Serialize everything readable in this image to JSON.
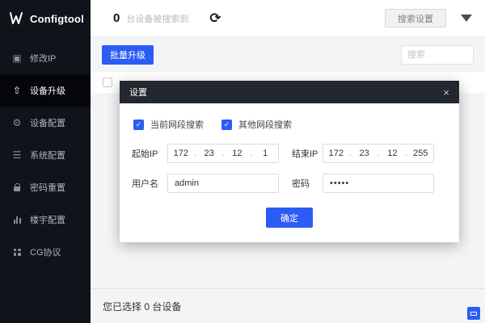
{
  "app": {
    "title": "Configtool"
  },
  "sidebar": {
    "items": [
      {
        "label": "修改IP"
      },
      {
        "label": "设备升级"
      },
      {
        "label": "设备配置"
      },
      {
        "label": "系统配置"
      },
      {
        "label": "密码重置"
      },
      {
        "label": "楼宇配置"
      },
      {
        "label": "CG协议"
      }
    ]
  },
  "topbar": {
    "device_count": "0",
    "device_count_label": "台设备被搜索到",
    "refresh_glyph": "⟳",
    "search_settings_label": "搜索设置"
  },
  "toolbar": {
    "batch_upgrade_label": "批量升级",
    "search_placeholder": "搜索"
  },
  "modal": {
    "title": "设置",
    "close_glyph": "×",
    "check_glyph": "✓",
    "checkbox_current_label": "当前网段搜索",
    "checkbox_other_label": "其他网段搜索",
    "start_ip_label": "起始IP",
    "start_ip": [
      "172",
      "23",
      "12",
      "1"
    ],
    "end_ip_label": "结束IP",
    "end_ip": [
      "172",
      "23",
      "12",
      "255"
    ],
    "ip_dot": ".",
    "username_label": "用户名",
    "username_value": "admin",
    "password_label": "密码",
    "password_value": "•••••",
    "ok_label": "确定"
  },
  "footer": {
    "selection_text": "您已选择 0 台设备"
  },
  "colors": {
    "accent": "#2b5cf6",
    "sidebar_bg": "#10141a",
    "modal_header_bg": "#23272e"
  },
  "icons": {
    "modify_ip": "▣",
    "device_upgrade": "⇧",
    "device_config": "⚙",
    "system_config": "☰"
  }
}
